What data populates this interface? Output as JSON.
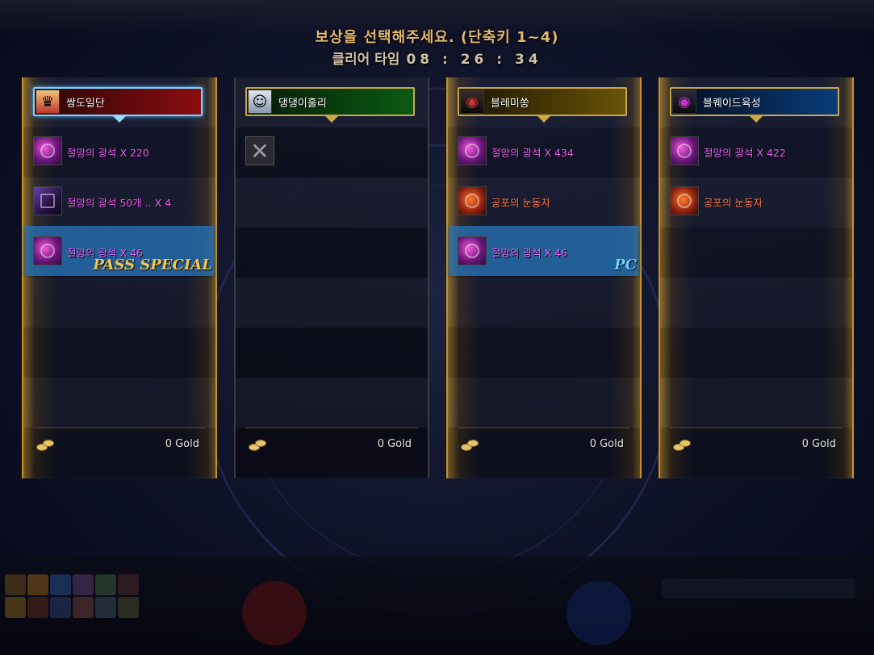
{
  "header": {
    "title": "보상을 선택해주세요. (단축키 1~4)",
    "clear_label": "클리어 타임",
    "clear_time": "08 : 26 : 34"
  },
  "columns": [
    {
      "player": "쌍도일단",
      "selected": true,
      "bar_color": "#8a0d10",
      "items": [
        {
          "label": "절망의 광석 X 220",
          "icon": "purple-ore-icon"
        },
        {
          "label": "절망의 광석 50개 .. X 4",
          "icon": "ore-bundle-icon"
        },
        {
          "label": "절망의 광석 X 46",
          "icon": "purple-ore-icon",
          "tag": "PASS SPECIAL"
        }
      ],
      "gold": "0 Gold"
    },
    {
      "player": "댕댕이훌리",
      "selected": false,
      "bar_color": "#0b5a12",
      "items": [
        {
          "label": "",
          "icon": "empty-x-icon"
        }
      ],
      "gold": "0 Gold"
    },
    {
      "player": "블레미쏭",
      "selected": false,
      "bar_color": "#6a5406",
      "items": [
        {
          "label": "절망의 광석 X 434",
          "icon": "purple-ore-icon"
        },
        {
          "label": "공포의 눈동자",
          "icon": "eye-gem-icon"
        },
        {
          "label": "절망의 광석 X 46",
          "icon": "purple-ore-icon",
          "tag": "PC"
        }
      ],
      "gold": "0 Gold"
    },
    {
      "player": "블퀘이드육성",
      "selected": false,
      "bar_color": "#0a3b7a",
      "items": [
        {
          "label": "절망의 광석 X 422",
          "icon": "purple-ore-icon"
        },
        {
          "label": "공포의 눈동자",
          "icon": "eye-gem-icon"
        }
      ],
      "gold": "0 Gold"
    }
  ],
  "colors": {
    "title": "#e2b870",
    "item_text": "#e85ff0",
    "rare_text": "#ff7a4a",
    "pass_tag": "#f6c64a",
    "pc_tag": "#6fd0ff",
    "frame_gold": "#c8901f"
  }
}
